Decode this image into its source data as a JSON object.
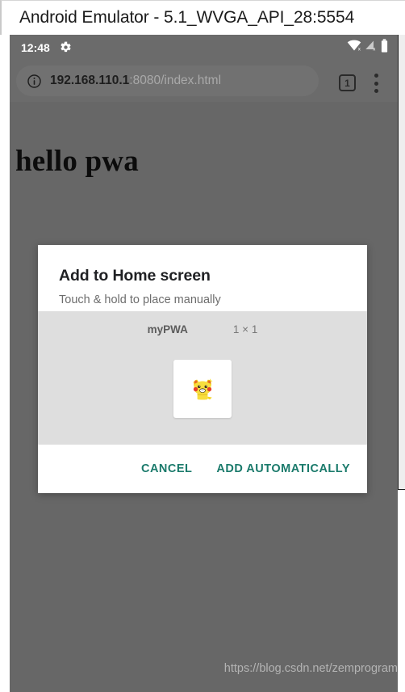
{
  "window": {
    "title": "Android Emulator - 5.1_WVGA_API_28:5554"
  },
  "statusbar": {
    "clock": "12:48",
    "gear_icon": "gear-icon",
    "wifi_icon": "wifi-off-icon",
    "signal_icon": "signal-off-icon",
    "battery_icon": "battery-icon"
  },
  "browser": {
    "info_icon": "info-circle-icon",
    "url_host": "192.168.110.1",
    "url_path": ":8080/index.html",
    "url_full": "192.168.110.1:8080/index.html",
    "tab_count": "1",
    "menu_icon": "overflow-menu-icon"
  },
  "page": {
    "heading": "hello pwa",
    "background_color": "#676767"
  },
  "dialog": {
    "title": "Add to Home screen",
    "subtitle": "Touch & hold to place manually",
    "preview": {
      "app_name": "myPWA",
      "size_label": "1 × 1",
      "icon_name": "pikachu-app-icon",
      "tile_background": "#ffffff",
      "section_background": "#dedede"
    },
    "buttons": {
      "cancel": "CANCEL",
      "add_automatically": "ADD AUTOMATICALLY",
      "accent_color": "#1a7a6b"
    }
  },
  "watermark": {
    "text": "https://blog.csdn.net/zemprogram"
  }
}
